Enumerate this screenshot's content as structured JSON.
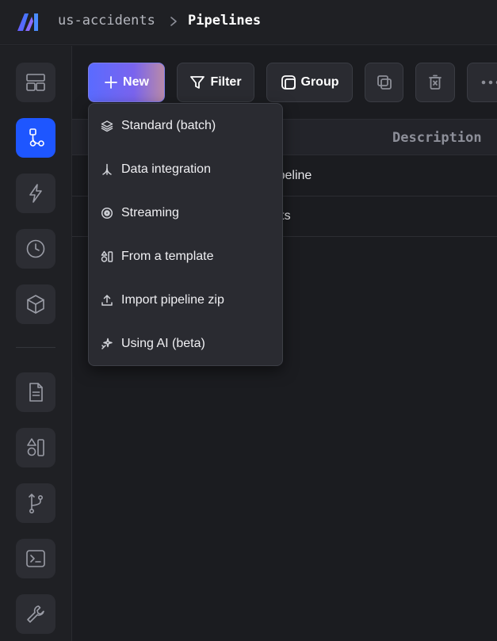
{
  "header": {
    "project": "us-accidents",
    "page": "Pipelines",
    "logo_icon": "mage-logo-icon"
  },
  "sidebar": {
    "items": [
      {
        "name": "overview",
        "icon": "layout-icon",
        "active": false
      },
      {
        "name": "pipelines",
        "icon": "pipeline-icon",
        "active": true
      },
      {
        "name": "triggers",
        "icon": "lightning-icon",
        "active": false
      },
      {
        "name": "runs",
        "icon": "clock-icon",
        "active": false
      },
      {
        "name": "blocks",
        "icon": "cube-icon",
        "active": false
      },
      {
        "name": "files",
        "icon": "file-icon",
        "active": false
      },
      {
        "name": "templates",
        "icon": "shapes-icon",
        "active": false
      },
      {
        "name": "version-control",
        "icon": "git-branch-icon",
        "active": false
      },
      {
        "name": "terminal",
        "icon": "terminal-icon",
        "active": false
      },
      {
        "name": "settings",
        "icon": "wrench-icon",
        "active": false
      }
    ]
  },
  "toolbar": {
    "new_label": "New",
    "filter_label": "Filter",
    "group_label": "Group",
    "clone_icon": "copy-icon",
    "delete_icon": "trash-icon",
    "more_icon": "more-icon"
  },
  "table": {
    "columns": {
      "name": "e",
      "description": "Description"
    },
    "rows": [
      {
        "name": "nple_pipeline"
      },
      {
        "name": "accidents"
      }
    ]
  },
  "new_menu": {
    "items": [
      {
        "label": "Standard (batch)",
        "icon": "layers-icon"
      },
      {
        "label": "Data integration",
        "icon": "integration-icon"
      },
      {
        "label": "Streaming",
        "icon": "streaming-icon"
      },
      {
        "label": "From a template",
        "icon": "template-icon"
      },
      {
        "label": "Import pipeline zip",
        "icon": "upload-icon"
      },
      {
        "label": "Using AI (beta)",
        "icon": "sparkle-icon"
      }
    ]
  },
  "colors": {
    "accent": "#1e56ff",
    "background": "#1b1c20",
    "panel": "#2a2b31"
  }
}
